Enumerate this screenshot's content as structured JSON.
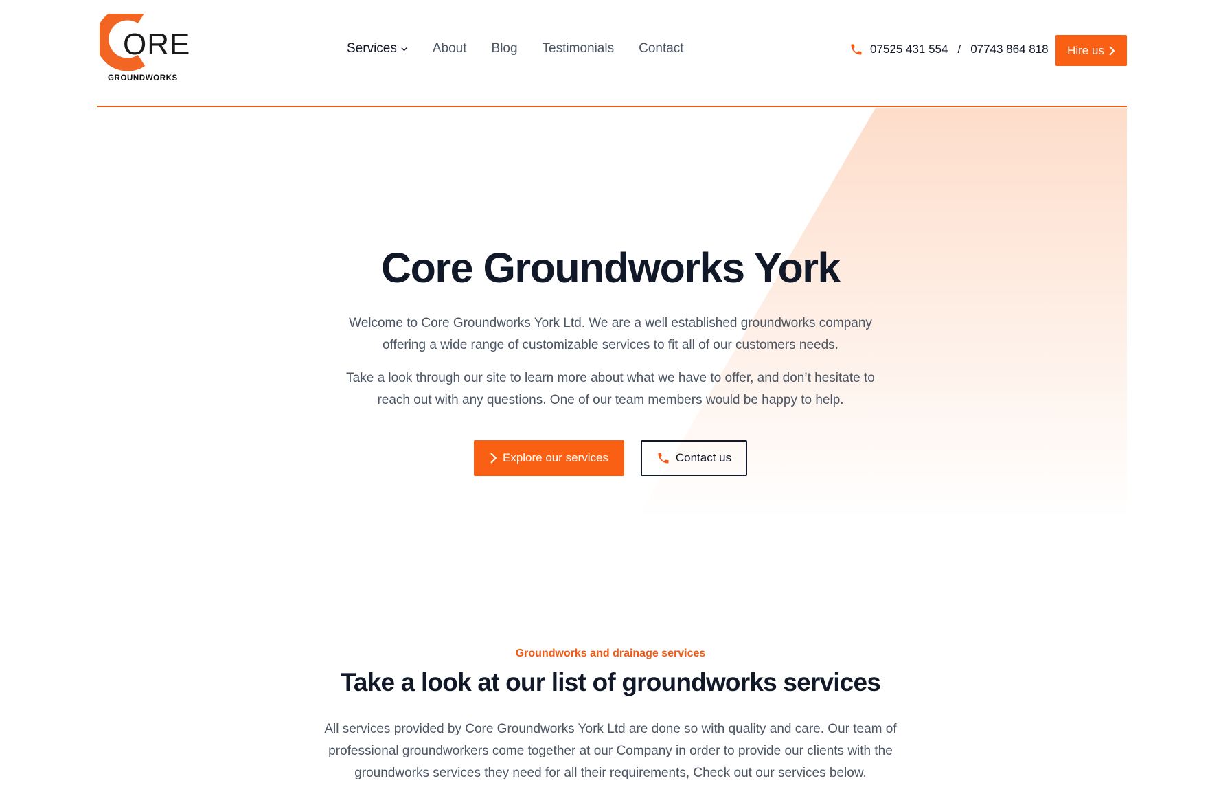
{
  "brand": {
    "logo_word": "ORE",
    "logo_sub": "GROUNDWORKS",
    "accent_color": "#fa6014"
  },
  "nav": {
    "items": [
      {
        "label": "Services",
        "has_dropdown": true
      },
      {
        "label": "About"
      },
      {
        "label": "Blog"
      },
      {
        "label": "Testimonials"
      },
      {
        "label": "Contact"
      }
    ]
  },
  "header": {
    "phone_icon": "phone-icon",
    "phone_1": "07525 431 554",
    "phone_separator": "/",
    "phone_2": "07743 864 818",
    "hire_label": "Hire us",
    "hire_icon": "chevron-right-icon"
  },
  "hero": {
    "title": "Core Groundworks York",
    "paragraph_1": "Welcome to Core Groundworks York Ltd. We are a well established groundworks company offering a wide range of customizable services to fit all of our customers needs.",
    "paragraph_2": "Take a look through our site to learn more about what we have to offer, and don’t hesitate to reach out with any questions. One of our team members would be happy to help.",
    "primary_button": "Explore our services",
    "secondary_button": "Contact us"
  },
  "services": {
    "eyebrow": "Groundworks and drainage services",
    "title": "Take a look at our list of groundworks services",
    "description": "All services provided by Core Groundworks York Ltd are done so with quality and care. Our team of professional groundworkers come together at our Company in order to provide our clients with the groundworks services they need for all their requirements, Check out our services below."
  }
}
